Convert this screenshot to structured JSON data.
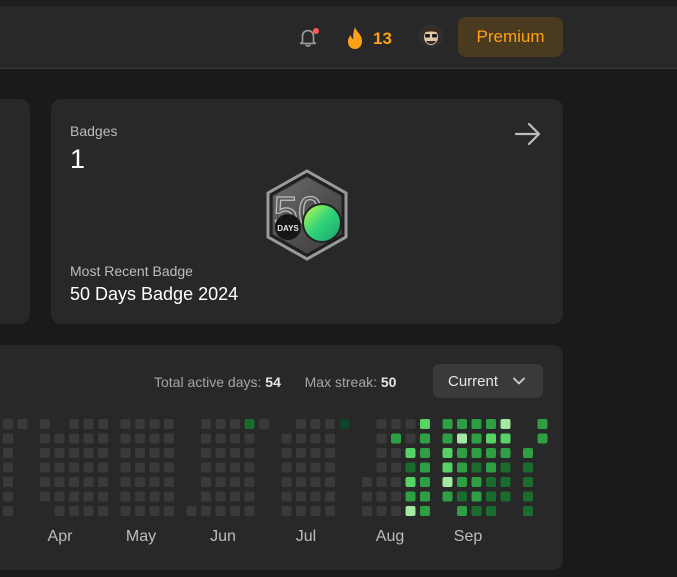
{
  "header": {
    "streak_count": "13",
    "premium_label": "Premium",
    "colors": {
      "accent": "#ffa116",
      "notification_dot": "#ff5a5a"
    }
  },
  "badges": {
    "label": "Badges",
    "count": "1",
    "badge_number": "50",
    "badge_days_text": "DAYS",
    "recent_label": "Most Recent Badge",
    "recent_name": "50 Days Badge 2024"
  },
  "activity": {
    "total_label": "Total active days:",
    "total_value": "54",
    "streak_label": "Max streak:",
    "streak_value": "50",
    "period_selected": "Current",
    "months": [
      {
        "label": "Apr"
      },
      {
        "label": "May"
      },
      {
        "label": "Jun"
      },
      {
        "label": "Jul"
      },
      {
        "label": "Aug"
      },
      {
        "label": "Sep"
      }
    ],
    "colors": {
      "empty": "#3a3a3a",
      "level1": "#0e4429",
      "level2": "#196c2e",
      "level3": "#2ea043",
      "level4": "#56d364",
      "level5": "#a3e9a4"
    }
  }
}
